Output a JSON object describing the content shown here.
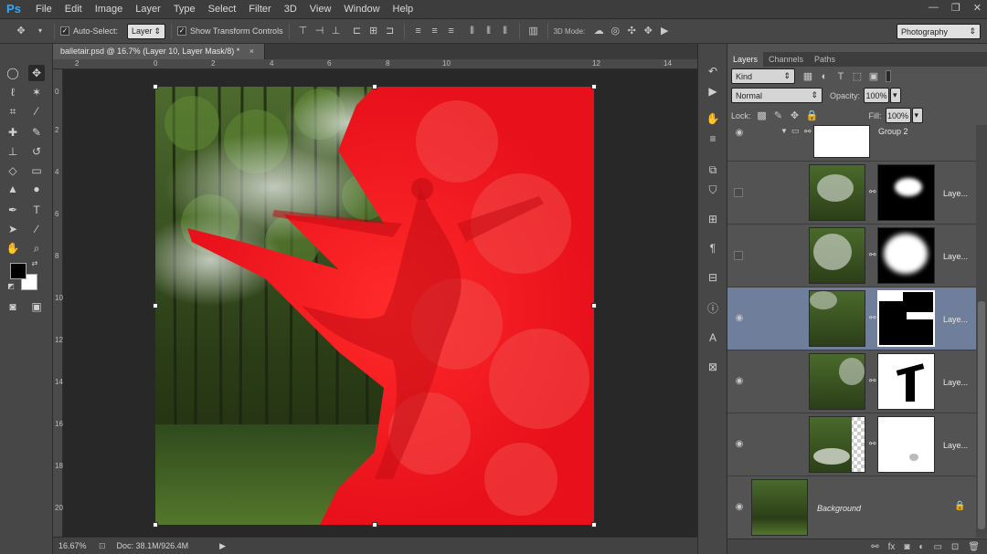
{
  "menubar": {
    "logo": "Ps",
    "items": [
      "File",
      "Edit",
      "Image",
      "Layer",
      "Type",
      "Select",
      "Filter",
      "3D",
      "View",
      "Window",
      "Help"
    ],
    "window_controls": [
      "—",
      "❐",
      "✕"
    ]
  },
  "options": {
    "auto_select_label": "Auto-Select:",
    "auto_select_checked": true,
    "auto_select_target": "Layer",
    "show_transform_label": "Show Transform Controls",
    "show_transform_checked": true,
    "mode_3d_label": "3D Mode:",
    "workspace": "Photography"
  },
  "document": {
    "tab_title": "balletair.psd @ 16.7% (Layer 10, Layer Mask/8) *",
    "ruler_top": [
      "2",
      "0",
      "2",
      "4",
      "6",
      "8",
      "10",
      "12",
      "14"
    ],
    "ruler_left": [
      "0",
      "2",
      "4",
      "6",
      "8",
      "10",
      "12",
      "14",
      "16",
      "18",
      "20"
    ],
    "zoom": "16.67%",
    "doc_info": "Doc: 38.1M/926.4M"
  },
  "layers_panel": {
    "tabs": [
      "Layers",
      "Channels",
      "Paths"
    ],
    "active_tab": "Layers",
    "filter_kind": "Kind",
    "blend_mode": "Normal",
    "opacity_label": "Opacity:",
    "opacity": "100%",
    "lock_label": "Lock:",
    "fill_label": "Fill:",
    "fill": "100%",
    "group_name": "Group 2",
    "layers": [
      {
        "name": "Laye...",
        "visible": false,
        "selected": false
      },
      {
        "name": "Laye...",
        "visible": false,
        "selected": false
      },
      {
        "name": "Laye...",
        "visible": true,
        "selected": true
      },
      {
        "name": "Laye...",
        "visible": true,
        "selected": false
      },
      {
        "name": "Laye...",
        "visible": true,
        "selected": false
      }
    ],
    "background_name": "Background",
    "footer_icons": [
      "link-icon",
      "fx-icon",
      "mask-icon",
      "adjustment-icon",
      "folder-icon",
      "new-layer-icon",
      "trash-icon"
    ]
  },
  "colors": {
    "accent": "#31a8ff",
    "selection": "#6f7e9a",
    "paint_red": "#e8101a"
  }
}
